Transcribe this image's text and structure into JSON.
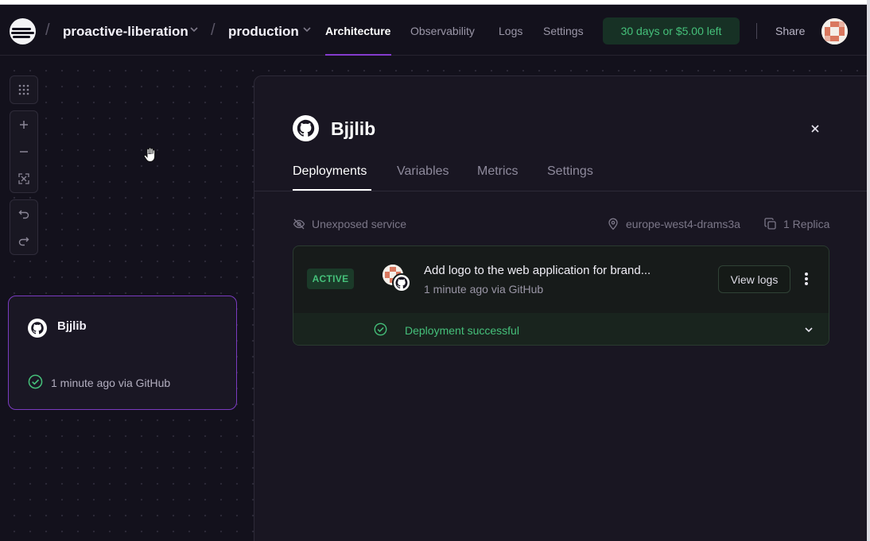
{
  "header": {
    "project": "proactive-liberation",
    "environment": "production",
    "nav": [
      "Architecture",
      "Observability",
      "Logs",
      "Settings"
    ],
    "active_nav": "Architecture",
    "trial": "30 days or $5.00 left",
    "share": "Share"
  },
  "canvas": {
    "tools": [
      "grid-icon",
      "zoom-in-icon",
      "zoom-out-icon",
      "fit-view-icon",
      "undo-icon",
      "redo-icon"
    ],
    "service_card": {
      "name": "Bjjlib",
      "status": "1 minute ago via GitHub"
    }
  },
  "panel": {
    "title": "Bjjlib",
    "tabs": [
      "Deployments",
      "Variables",
      "Metrics",
      "Settings"
    ],
    "active_tab": "Deployments",
    "exposure": "Unexposed service",
    "region": "europe-west4-drams3a",
    "replicas": "1 Replica",
    "deployment": {
      "badge": "ACTIVE",
      "message": "Add logo to the web application for brand...",
      "meta": "1 minute ago via GitHub",
      "view_logs": "View logs",
      "status": "Deployment successful"
    }
  },
  "colors": {
    "accent": "#853bce",
    "success": "#45c07a",
    "background": "#13111c"
  }
}
